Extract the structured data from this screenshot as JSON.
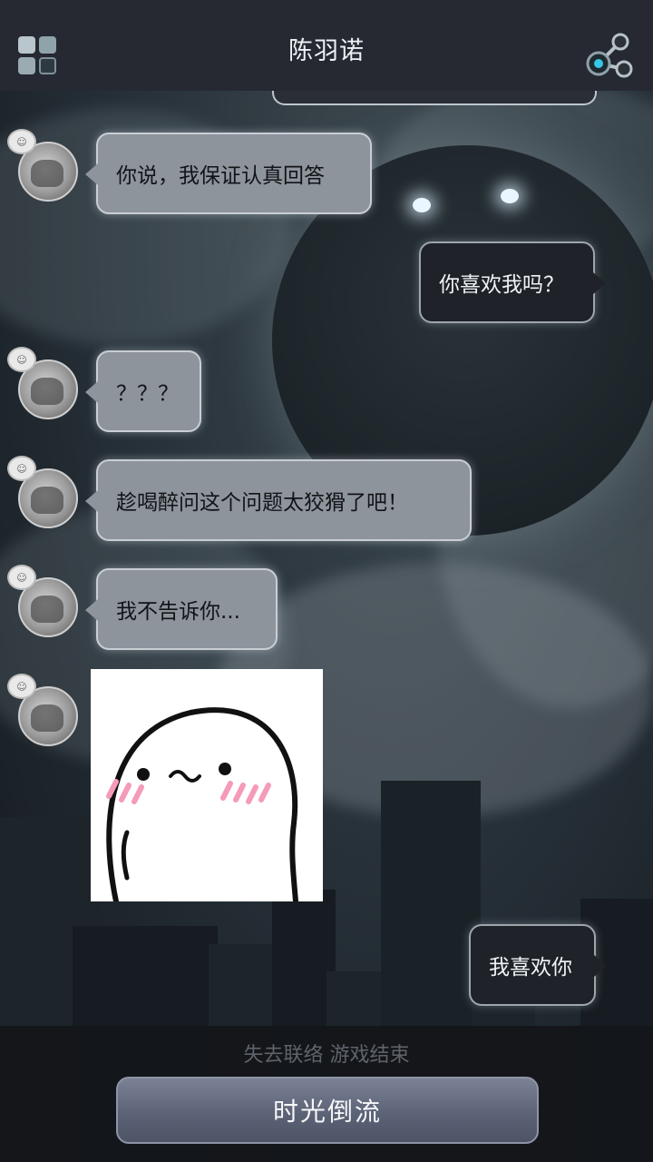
{
  "header": {
    "title": "陈羽诺",
    "menu_icon": "grid-menu-icon",
    "share_icon": "share-icon"
  },
  "messages": [
    {
      "side": "left",
      "text": "你说，我保证认真回答"
    },
    {
      "side": "right",
      "text": "你喜欢我吗？"
    },
    {
      "side": "left",
      "text": "？？？"
    },
    {
      "side": "left",
      "text": "趁喝醉问这个问题太狡猾了吧！"
    },
    {
      "side": "left",
      "text": "我不告诉你..."
    },
    {
      "side": "left",
      "type": "sticker",
      "sticker": "blushing-blob-sticker"
    },
    {
      "side": "right",
      "text": "我喜欢你"
    }
  ],
  "footer": {
    "status": "失去联络 游戏结束",
    "button_label": "时光倒流"
  },
  "colors": {
    "topbar": "#262932",
    "left_bubble": "#8e949c",
    "right_bubble": "#1f2329",
    "button": "#5c6376"
  }
}
